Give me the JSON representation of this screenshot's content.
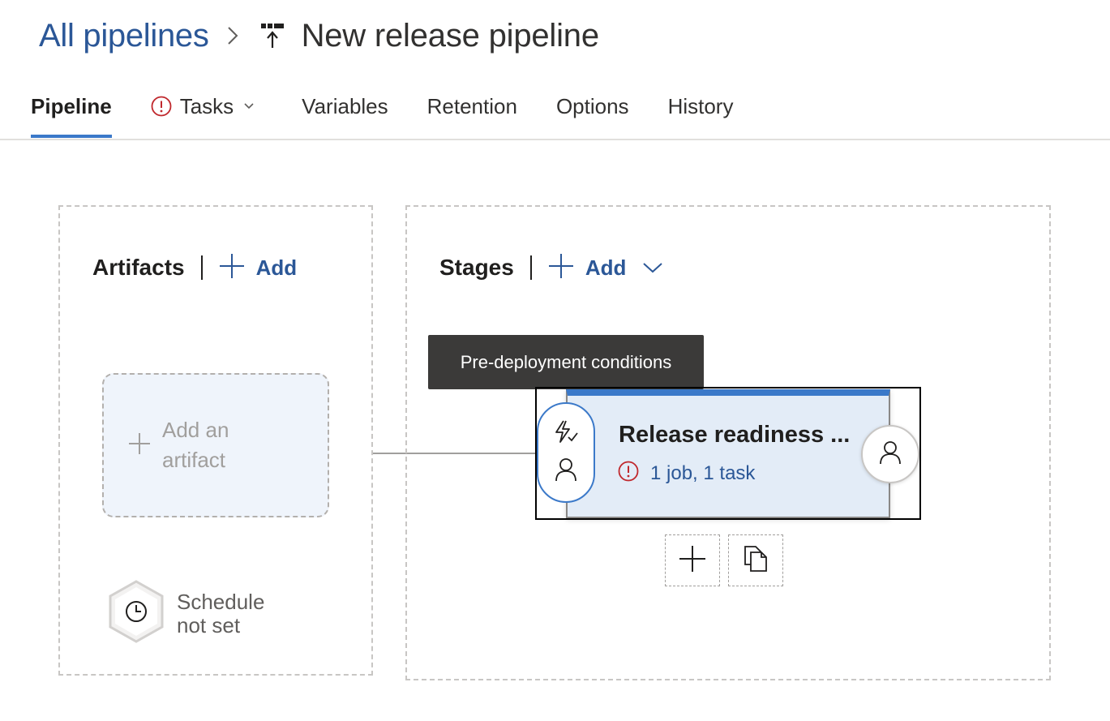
{
  "breadcrumb": {
    "parent": "All pipelines",
    "title": "New release pipeline"
  },
  "tabs": [
    {
      "label": "Pipeline",
      "active": true
    },
    {
      "label": "Tasks",
      "warning": true,
      "dropdown": true
    },
    {
      "label": "Variables"
    },
    {
      "label": "Retention"
    },
    {
      "label": "Options"
    },
    {
      "label": "History"
    }
  ],
  "artifacts": {
    "title": "Artifacts",
    "add_label": "Add",
    "add_artifact_label": "Add an artifact",
    "schedule_label": "Schedule not set"
  },
  "stages": {
    "title": "Stages",
    "add_label": "Add",
    "tooltip": "Pre-deployment conditions",
    "stage": {
      "name": "Release readiness ...",
      "status": "1 job, 1 task"
    }
  },
  "icons": {
    "warning": "error-circle-icon",
    "chevron": "chevron-down-icon",
    "add": "plus-icon",
    "schedule": "clock-icon",
    "trigger": "lightning-icon",
    "approver": "person-icon",
    "clone": "copy-icon"
  },
  "colors": {
    "link": "#2b5797",
    "accent": "#3b79c9",
    "warning": "#c0282d",
    "tooltip_bg": "#3b3a39",
    "stage_bg": "#e3ecf7",
    "artifact_bg": "#eff4fb"
  }
}
